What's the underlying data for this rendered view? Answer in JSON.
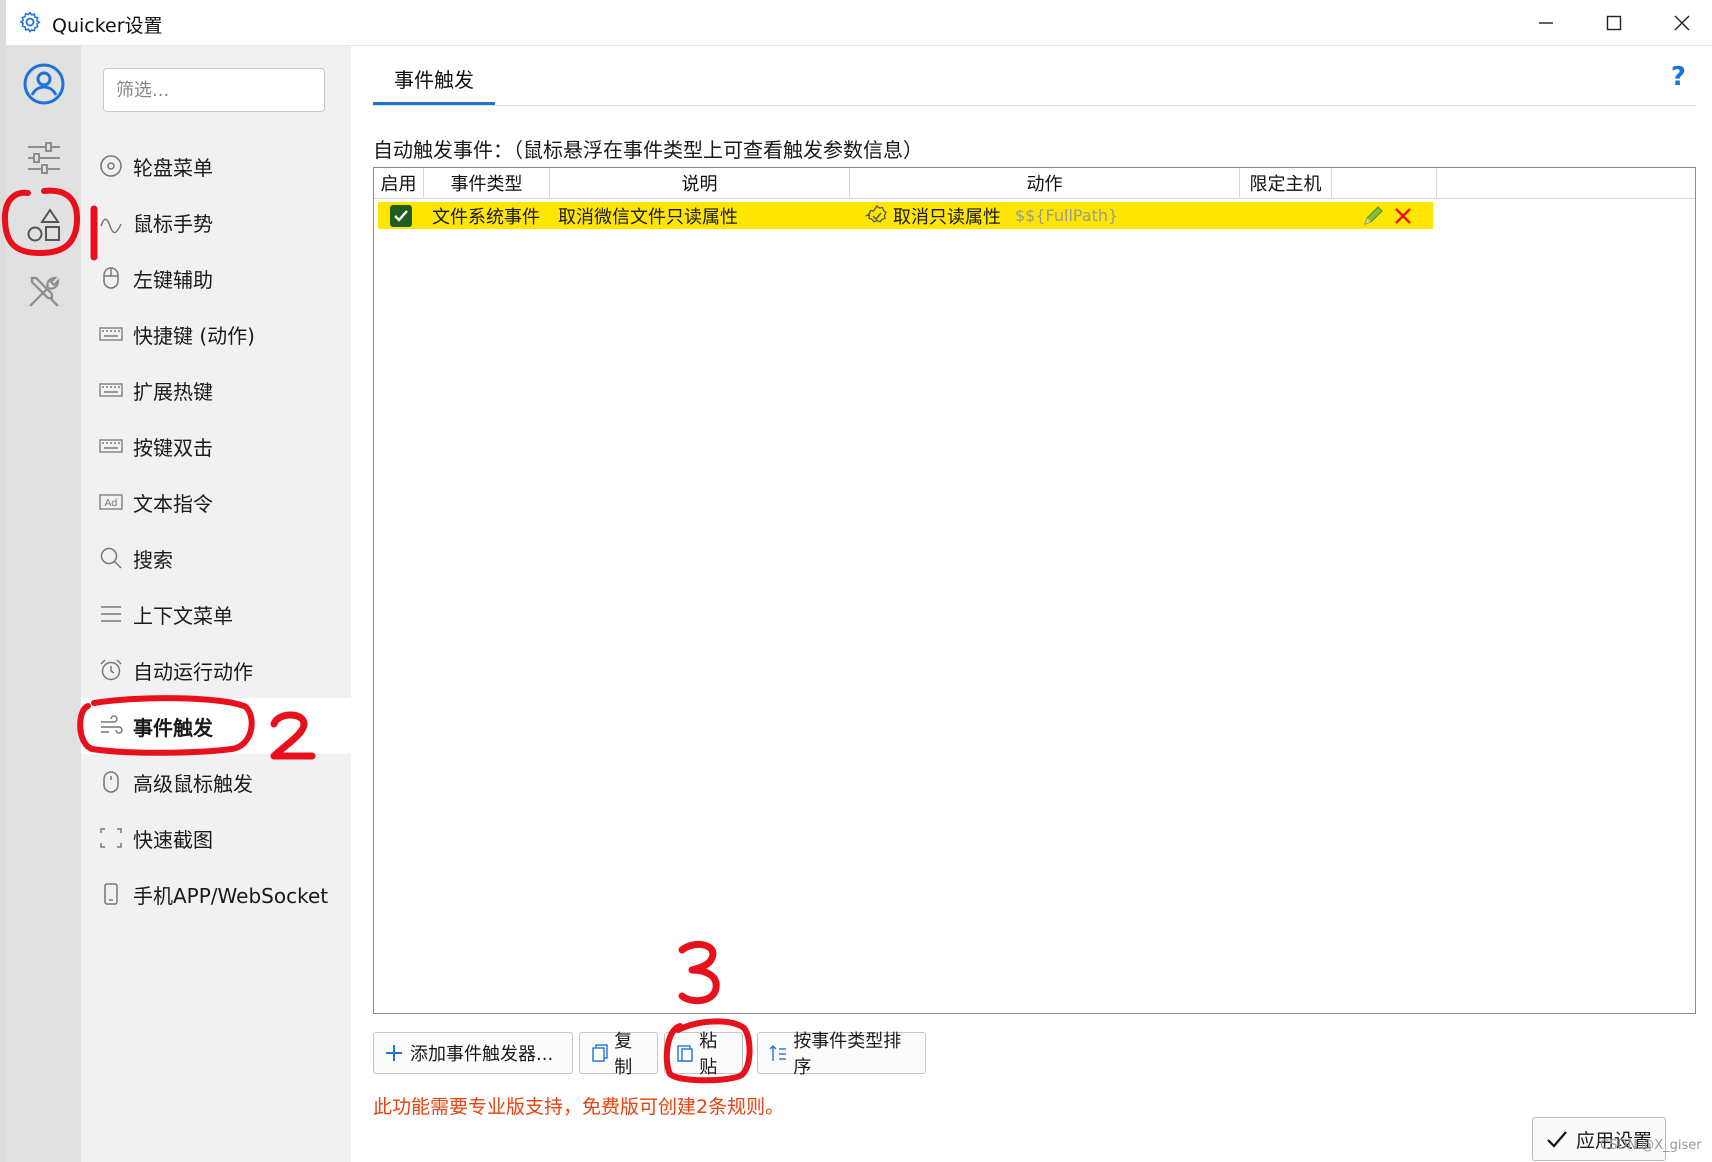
{
  "window": {
    "title": "Quicker设置"
  },
  "filter": {
    "placeholder": "筛选..."
  },
  "nav": {
    "items": [
      {
        "label": "轮盘菜单",
        "icon": "wheel-icon"
      },
      {
        "label": "鼠标手势",
        "icon": "gesture-icon"
      },
      {
        "label": "左键辅助",
        "icon": "mouse-icon"
      },
      {
        "label": "快捷键 (动作)",
        "icon": "keyboard-icon"
      },
      {
        "label": "扩展热键",
        "icon": "keyboard-icon"
      },
      {
        "label": "按键双击",
        "icon": "keyboard-icon"
      },
      {
        "label": "文本指令",
        "icon": "ad-icon"
      },
      {
        "label": "搜索",
        "icon": "search-icon"
      },
      {
        "label": "上下文菜单",
        "icon": "menu-icon"
      },
      {
        "label": "自动运行动作",
        "icon": "alarm-icon"
      },
      {
        "label": "事件触发",
        "icon": "wind-icon",
        "active": true
      },
      {
        "label": "高级鼠标触发",
        "icon": "mouse-icon"
      },
      {
        "label": "快速截图",
        "icon": "screenshot-icon"
      },
      {
        "label": "手机APP/WebSocket",
        "icon": "phone-icon"
      }
    ]
  },
  "main": {
    "tab": "事件触发",
    "help": "?",
    "hint": "自动触发事件：（鼠标悬浮在事件类型上可查看触发参数信息）",
    "columns": [
      "启用",
      "事件类型",
      "说明",
      "动作",
      "限定主机"
    ],
    "rows": [
      {
        "enabled": true,
        "event_type": "文件系统事件",
        "description": "取消微信文件只读属性",
        "action": "取消只读属性",
        "action_param": "$${FullPath}",
        "host": ""
      }
    ],
    "buttons": {
      "add": "添加事件触发器...",
      "copy": "复制",
      "paste": "粘贴",
      "sort": "按事件类型排序"
    },
    "note": "此功能需要专业版支持，免费版可创建2条规则。",
    "apply": "应用设置"
  },
  "annotations": {
    "one": "1",
    "two": "2",
    "three": "3"
  },
  "watermark": "CSDN @X_giser",
  "colors": {
    "accent": "#1e73d8",
    "row_highlight": "#ffe600",
    "note": "#e8420e",
    "annotation": "#e8101a"
  }
}
